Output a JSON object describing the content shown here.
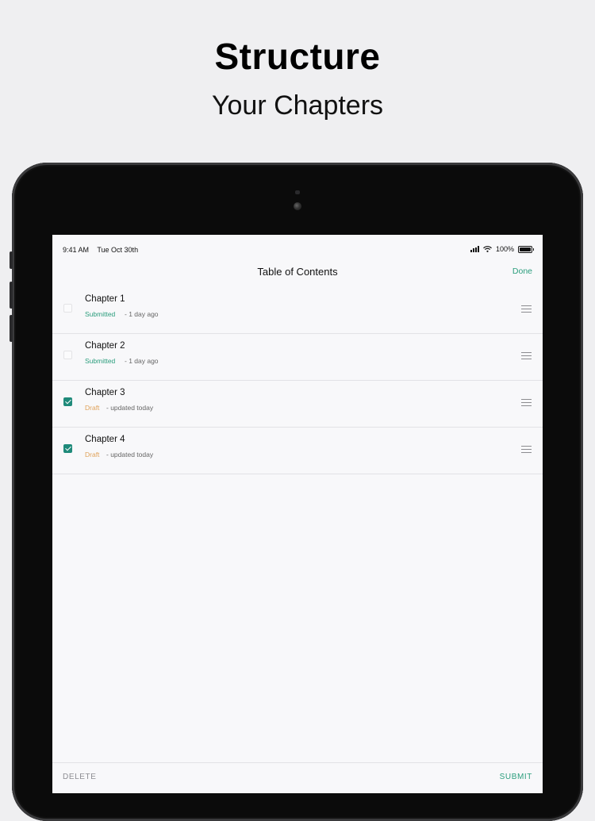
{
  "marketing": {
    "headline": "Structure",
    "subheadline": "Your Chapters"
  },
  "status_bar": {
    "time": "9:41 AM",
    "date": "Tue Oct 30th",
    "battery": "100%"
  },
  "nav": {
    "title": "Table of Contents",
    "done_label": "Done"
  },
  "chapters": [
    {
      "title": "Chapter 1",
      "status": "Submitted",
      "meta": "- 1 day ago",
      "checked": false
    },
    {
      "title": "Chapter 2",
      "status": "Submitted",
      "meta": "- 1 day ago",
      "checked": false
    },
    {
      "title": "Chapter 3",
      "status": "Draft",
      "meta": "- updated today",
      "checked": true
    },
    {
      "title": "Chapter 4",
      "status": "Draft",
      "meta": "- updated today",
      "checked": true
    }
  ],
  "toolbar": {
    "delete_label": "DELETE",
    "submit_label": "SUBMIT"
  },
  "colors": {
    "accent": "#2a9d7c",
    "submitted": "#2a9d7c",
    "draft": "#e0a25a",
    "checkbox_checked": "#1f8a7a"
  }
}
